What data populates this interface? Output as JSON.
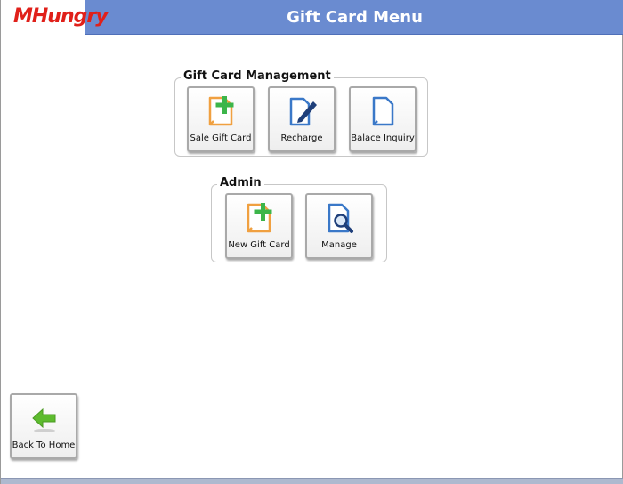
{
  "header": {
    "logo_text": "MHungry",
    "title": "Gift Card Menu"
  },
  "management": {
    "title": "Gift Card Management",
    "buttons": [
      {
        "label": "Sale Gift Card",
        "icon": "document-plus-icon"
      },
      {
        "label": "Recharge",
        "icon": "document-pen-icon"
      },
      {
        "label": "Balace Inquiry",
        "icon": "document-icon"
      }
    ]
  },
  "admin": {
    "title": "Admin",
    "buttons": [
      {
        "label": "New Gift Card",
        "icon": "document-plus-icon"
      },
      {
        "label": "Manage",
        "icon": "document-search-icon"
      }
    ]
  },
  "back": {
    "label": "Back To Home",
    "icon": "arrow-left-icon"
  },
  "colors": {
    "header_bg": "#6a8bd0",
    "logo_red": "#e0201a",
    "doc_orange": "#f0a040",
    "doc_blue": "#3a78c8",
    "plus_green": "#3cb54a",
    "arrow_green": "#5dbb2e"
  }
}
